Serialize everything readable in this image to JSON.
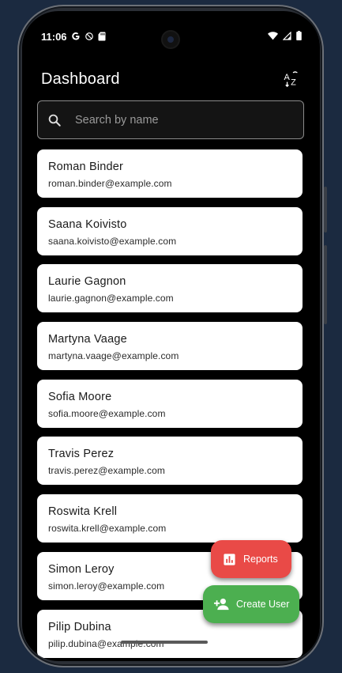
{
  "status_bar": {
    "time": "11:06",
    "left_icons": [
      "google-icon",
      "dnd-icon",
      "sdcard-icon"
    ],
    "right_icons": [
      "wifi-icon",
      "signal-icon",
      "battery-icon"
    ]
  },
  "app_bar": {
    "title": "Dashboard",
    "sort_icon": "sort-az-icon"
  },
  "search": {
    "placeholder": "Search by name",
    "value": ""
  },
  "users": [
    {
      "name": "Roman Binder",
      "email": "roman.binder@example.com"
    },
    {
      "name": "Saana Koivisto",
      "email": "saana.koivisto@example.com"
    },
    {
      "name": "Laurie Gagnon",
      "email": "laurie.gagnon@example.com"
    },
    {
      "name": "Martyna Vaage",
      "email": "martyna.vaage@example.com"
    },
    {
      "name": "Sofia Moore",
      "email": "sofia.moore@example.com"
    },
    {
      "name": "Travis Perez",
      "email": "travis.perez@example.com"
    },
    {
      "name": "Roswita Krell",
      "email": "roswita.krell@example.com"
    },
    {
      "name": "Simon Leroy",
      "email": "simon.leroy@example.com"
    },
    {
      "name": "Pilip Dubina",
      "email": "pilip.dubina@example.com"
    }
  ],
  "fabs": {
    "reports": {
      "label": "Reports",
      "icon": "bar-chart-icon",
      "color": "#e94a47"
    },
    "create_user": {
      "label": "Create User",
      "icon": "person-add-icon",
      "color": "#4caf50"
    }
  }
}
